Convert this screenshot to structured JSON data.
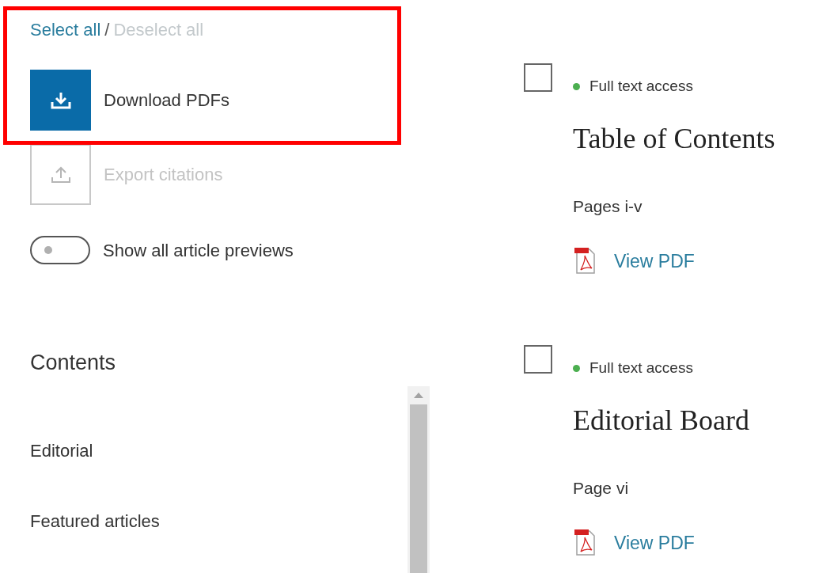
{
  "selection": {
    "select_all": "Select all",
    "separator": "/",
    "deselect_all": "Deselect all",
    "deselect_disabled": true
  },
  "actions": [
    {
      "kind": "download",
      "label": "Download PDFs",
      "disabled": false
    },
    {
      "kind": "export",
      "label": "Export citations",
      "disabled": true
    }
  ],
  "preview_toggle": {
    "label": "Show all article previews",
    "on": false
  },
  "contents": {
    "title": "Contents",
    "items": [
      "Editorial",
      "Featured articles"
    ]
  },
  "articles": [
    {
      "checked": false,
      "access": "Full text access",
      "title": "Table of Contents",
      "pages": "Pages i-v",
      "link": "View PDF"
    },
    {
      "checked": false,
      "access": "Full text access",
      "title": "Editorial Board",
      "pages": "Page vi",
      "link": "View PDF"
    }
  ],
  "highlight": true
}
